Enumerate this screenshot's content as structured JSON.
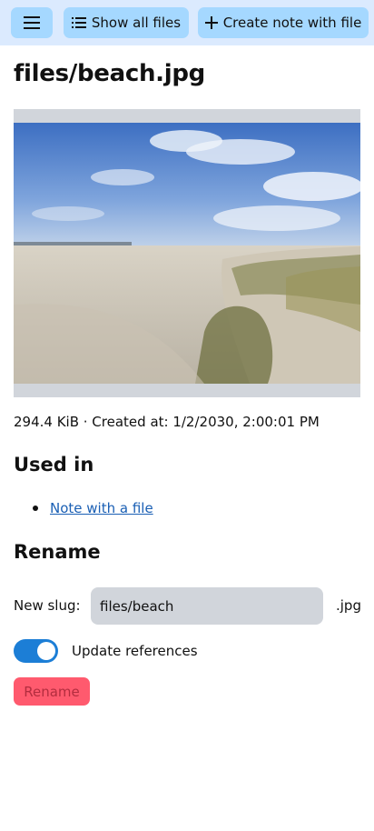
{
  "toolbar": {
    "menu_icon": "hamburger-menu-icon",
    "show_all_files_label": "Show all files",
    "show_all_files_icon": "list-icon",
    "create_note_label": "Create note with file",
    "create_note_icon": "plus-icon"
  },
  "file": {
    "title": "files/beach.jpg",
    "meta": "294.4 KiB · Created at: 1/2/2030, 2:00:01 PM"
  },
  "used_in": {
    "heading": "Used in",
    "items": [
      {
        "label": "Note with a file"
      }
    ]
  },
  "rename": {
    "heading": "Rename",
    "slug_label": "New slug:",
    "slug_value": "files/beach",
    "extension": ".jpg",
    "update_references_label": "Update references",
    "update_references_on": true,
    "button_label": "Rename"
  },
  "colors": {
    "topbar_bg": "#dbeafe",
    "button_bg": "#a5d8ff",
    "toggle_on": "#1c7ed6",
    "rename_button": "#ff5a6e",
    "link": "#1a5fb4"
  }
}
